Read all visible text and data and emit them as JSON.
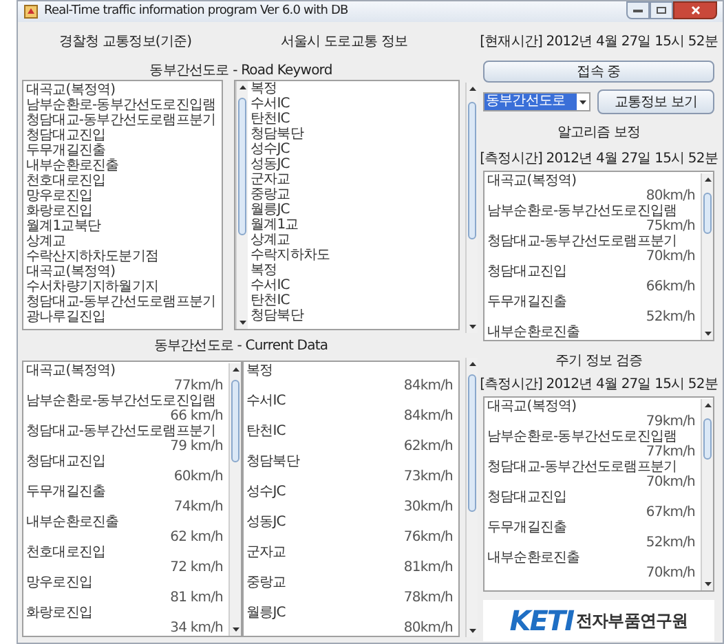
{
  "window": {
    "title": "Real-Time traffic information program Ver 6.0 with DB"
  },
  "header": {
    "police_title": "경찰청 교통정보(기준)",
    "seoul_title": "서울시 도로교통 정보",
    "current_time": "[현재시간] 2012년 4월 27일 15시 52분"
  },
  "keyword_title": "동부간선도로 - Road Keyword",
  "connect_button": "접속 중",
  "keyword_lists": {
    "sections": [
      "대곡교(복정역)",
      "남부순환로-동부간선도로진입램",
      "청담대교-동부간선도로램프분기",
      "청담대교진입",
      "두무개길진출",
      "내부순환로진출",
      "천호대로진입",
      "망우로진입",
      "화랑로진입",
      "월계1교북단",
      "상계교",
      "수락산지하차도분기점",
      "대곡교(복정역)",
      "수서차량기지하월기지",
      "청담대교-동부간선도로램프분기",
      "광나루길진입"
    ],
    "interchanges": [
      "복정",
      "수서IC",
      "탄천IC",
      "청담북단",
      "성수JC",
      "성동JC",
      "군자교",
      "중랑교",
      "월릉JC",
      "월계1교",
      "상계교",
      "수락지하차도",
      "복정",
      "수서IC",
      "탄천IC",
      "청담북단"
    ]
  },
  "road_select": {
    "value": "동부간선도로",
    "selected": true
  },
  "view_button": "교통정보 보기",
  "algorithm": {
    "title": "알고리즘 보정",
    "time": "[측정시간] 2012년 4월 27일 15시 52분",
    "rows": [
      {
        "name": "대곡교(복정역)",
        "speed": "80km/h"
      },
      {
        "name": "남부순환로-동부간선도로진입램",
        "speed": "75km/h"
      },
      {
        "name": "청담대교-동부간선도로램프분기",
        "speed": "70km/h"
      },
      {
        "name": "청담대교진입",
        "speed": "66km/h"
      },
      {
        "name": "두무개길진출",
        "speed": "52km/h"
      },
      {
        "name": "내부순환로진출"
      }
    ]
  },
  "current_title": "동부간선도로 - Current Data",
  "current_data": {
    "left": [
      {
        "name": "대곡교(복정역)",
        "speed": "77km/h"
      },
      {
        "name": "남부순환로-동부간선도로진입램",
        "speed": "66 km/h"
      },
      {
        "name": "청담대교-동부간선도로램프분기",
        "speed": "79 km/h"
      },
      {
        "name": "청담대교진입",
        "speed": "60km/h"
      },
      {
        "name": "두무개길진출",
        "speed": "74km/h"
      },
      {
        "name": "내부순환로진출",
        "speed": "62 km/h"
      },
      {
        "name": "천호대로진입",
        "speed": "72 km/h"
      },
      {
        "name": "망우로진입",
        "speed": "81 km/h"
      },
      {
        "name": "화랑로진입",
        "speed": "34 km/h"
      }
    ],
    "right": [
      {
        "name": "복정",
        "speed": "84km/h"
      },
      {
        "name": "수서IC",
        "speed": "84km/h"
      },
      {
        "name": "탄천IC",
        "speed": "62km/h"
      },
      {
        "name": "청담북단",
        "speed": "73km/h"
      },
      {
        "name": "성수JC",
        "speed": "30km/h"
      },
      {
        "name": "성동JC",
        "speed": "76km/h"
      },
      {
        "name": "군자교",
        "speed": "81km/h"
      },
      {
        "name": "중랑교",
        "speed": "78km/h"
      },
      {
        "name": "월릉JC",
        "speed": "80km/h"
      }
    ]
  },
  "periodic": {
    "title": "주기 정보 검증",
    "time": "[측정시간] 2012년 4월 27일 15시 52분",
    "rows": [
      {
        "name": "대곡교(복정역)",
        "speed": "79km/h"
      },
      {
        "name": "남부순환로-동부간선도로진입램",
        "speed": "77km/h"
      },
      {
        "name": "청담대교-동부간선도로램프분기",
        "speed": "70km/h"
      },
      {
        "name": "청담대교진입",
        "speed": "67km/h"
      },
      {
        "name": "두무개길진출",
        "speed": "52km/h"
      },
      {
        "name": "내부순환로진출",
        "speed": "70km/h"
      }
    ]
  },
  "logo": {
    "mark": "KETI",
    "name": "전자부품연구원"
  }
}
